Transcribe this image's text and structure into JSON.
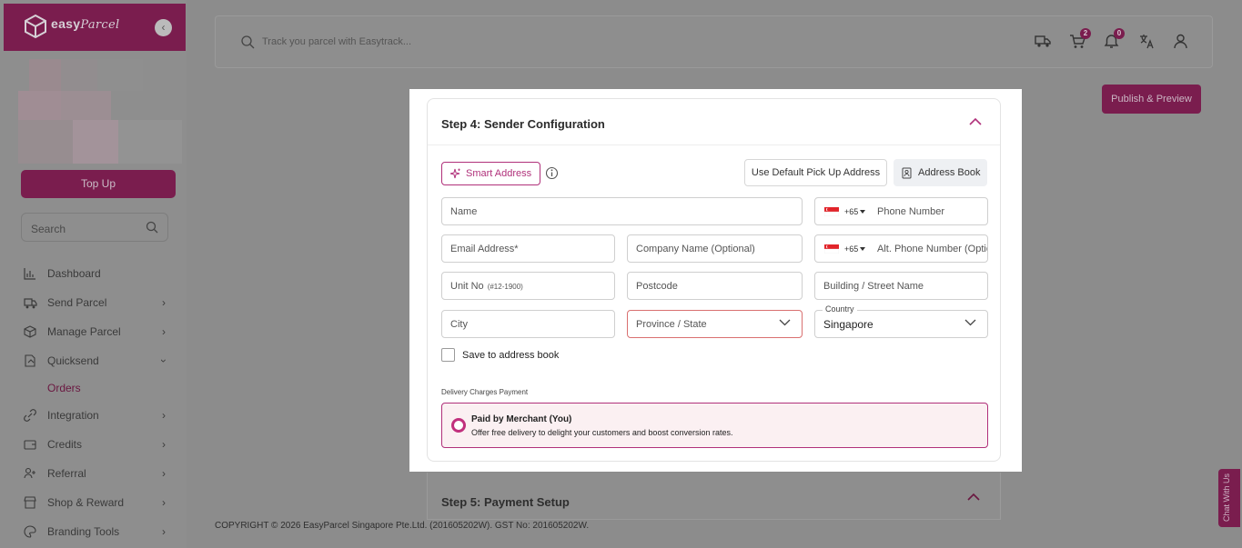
{
  "brand": {
    "name": "easy",
    "name_script": "Parcel"
  },
  "sidebar": {
    "topup_label": "Top Up",
    "search_placeholder": "Search",
    "items": [
      {
        "label": "Dashboard",
        "icon": "chart-icon",
        "has_children": false
      },
      {
        "label": "Send Parcel",
        "icon": "truck-icon",
        "has_children": true
      },
      {
        "label": "Manage Parcel",
        "icon": "box-icon",
        "has_children": true
      },
      {
        "label": "Quicksend",
        "icon": "quicksend-icon",
        "has_children": true,
        "expanded": true
      },
      {
        "label": "Integration",
        "icon": "link-icon",
        "has_children": true
      },
      {
        "label": "Credits",
        "icon": "wallet-icon",
        "has_children": true
      },
      {
        "label": "Referral",
        "icon": "user-plus-icon",
        "has_children": true
      },
      {
        "label": "Shop & Reward",
        "icon": "shop-icon",
        "has_children": true
      },
      {
        "label": "Branding Tools",
        "icon": "palette-icon",
        "has_children": true
      }
    ],
    "subitem_orders": "Orders"
  },
  "topbar": {
    "track_placeholder": "Track you parcel with Easytrack...",
    "cart_count": "2",
    "notif_count": "0"
  },
  "publish_label": "Publish & Preview",
  "step4": {
    "title": "Step 4: Sender Configuration",
    "smart_address": "Smart Address",
    "use_default": "Use Default Pick Up Address",
    "address_book": "Address Book",
    "fields": {
      "name": "Name",
      "email": "Email Address*",
      "company": "Company Name (Optional)",
      "unit": "Unit No",
      "unit_hint": "(#12-1900)",
      "postcode": "Postcode",
      "building": "Building / Street Name",
      "city": "City",
      "province": "Province / State",
      "country_label": "Country",
      "country_value": "Singapore",
      "phone_code": "+65",
      "phone": "Phone Number",
      "alt_phone_code": "+65",
      "alt_phone": "Alt. Phone Number (Optional)"
    },
    "save_to_book": "Save to address book",
    "delivery_charges_label": "Delivery Charges Payment",
    "payment_option": {
      "title": "Paid by Merchant (You)",
      "description": "Offer free delivery to delight your customers and boost conversion rates."
    }
  },
  "step5": {
    "title": "Step 5: Payment Setup"
  },
  "footer": {
    "copyright": "COPYRIGHT © 2026 EasyParcel Singapore Pte.Ltd. (201605202W). GST No: 201605202W."
  },
  "chat_label": "Chat With Us",
  "colors": {
    "brand": "#7a1d4e",
    "accent": "#b0307a",
    "overlay": "#8c8c8c"
  }
}
